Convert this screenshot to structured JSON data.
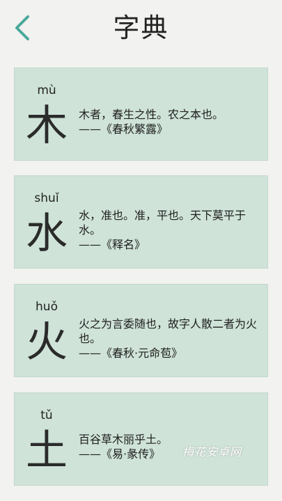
{
  "header": {
    "title": "字典",
    "back_icon": "chevron-left-icon",
    "accent_color": "#4aa99b"
  },
  "cards": [
    {
      "pinyin": "mù",
      "character": "木",
      "quote": "木者，春生之性。农之本也。",
      "source": "——《春秋繁露》"
    },
    {
      "pinyin": "shuǐ",
      "character": "水",
      "quote": "水，准也。准，平也。天下莫平于水。",
      "source": "——《释名》"
    },
    {
      "pinyin": "huǒ",
      "character": "火",
      "quote": "火之为言委随也，故字人散二者为火也。",
      "source": "——《春秋·元命苞》"
    },
    {
      "pinyin": "tǔ",
      "character": "土",
      "quote": "百谷草木丽乎土。",
      "source": "——《易·彖传》"
    }
  ],
  "watermark": "梅花安卓网",
  "colors": {
    "background": "#f2f2f0",
    "card": "#cfe3d8"
  }
}
